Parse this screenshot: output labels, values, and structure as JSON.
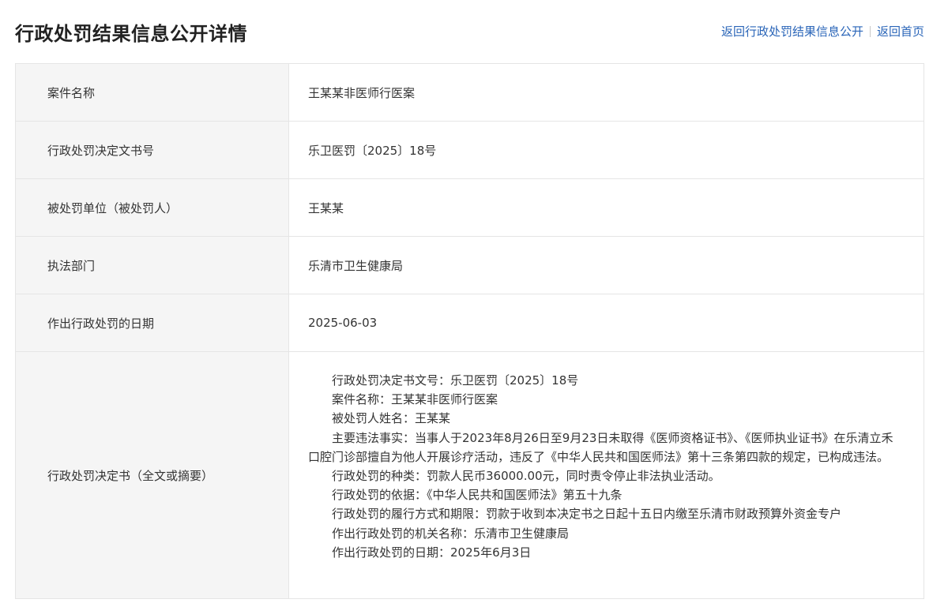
{
  "header": {
    "title": "行政处罚结果信息公开详情",
    "nav": {
      "back_list": "返回行政处罚结果信息公开",
      "back_home": "返回首页"
    }
  },
  "rows": [
    {
      "label": "案件名称",
      "value": "王某某非医师行医案"
    },
    {
      "label": "行政处罚决定文书号",
      "value": "乐卫医罚〔2025〕18号"
    },
    {
      "label": "被处罚单位（被处罚人）",
      "value": "王某某"
    },
    {
      "label": "执法部门",
      "value": "乐清市卫生健康局"
    },
    {
      "label": "作出行政处罚的日期",
      "value": "2025-06-03"
    }
  ],
  "decision": {
    "label": "行政处罚决定书（全文或摘要）",
    "paragraphs": [
      "行政处罚决定书文号：乐卫医罚〔2025〕18号",
      "案件名称：王某某非医师行医案",
      "被处罚人姓名：王某某",
      "主要违法事实：当事人于2023年8月26日至9月23日未取得《医师资格证书》、《医师执业证书》在乐清立禾口腔门诊部擅自为他人开展诊疗活动，违反了《中华人民共和国医师法》第十三条第四款的规定，已构成违法。",
      "行政处罚的种类：罚款人民币36000.00元，同时责令停止非法执业活动。",
      "行政处罚的依据：《中华人民共和国医师法》第五十九条",
      "行政处罚的履行方式和期限：罚款于收到本决定书之日起十五日内缴至乐清市财政预算外资金专户",
      "作出行政处罚的机关名称：乐清市卫生健康局",
      "作出行政处罚的日期：2025年6月3日"
    ]
  }
}
